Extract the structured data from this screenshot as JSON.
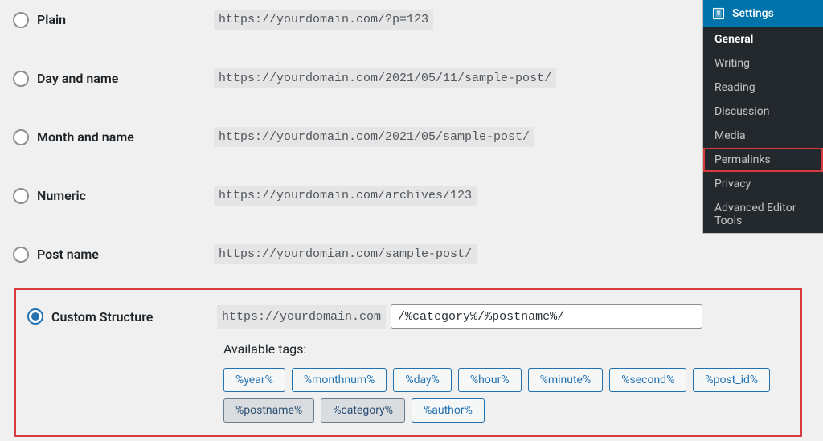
{
  "sidebar": {
    "header": "Settings",
    "items": [
      {
        "label": "General",
        "current": true,
        "highlight": false
      },
      {
        "label": "Writing",
        "current": false,
        "highlight": false
      },
      {
        "label": "Reading",
        "current": false,
        "highlight": false
      },
      {
        "label": "Discussion",
        "current": false,
        "highlight": false
      },
      {
        "label": "Media",
        "current": false,
        "highlight": false
      },
      {
        "label": "Permalinks",
        "current": false,
        "highlight": true
      },
      {
        "label": "Privacy",
        "current": false,
        "highlight": false
      },
      {
        "label": "Advanced Editor Tools",
        "current": false,
        "highlight": false
      }
    ]
  },
  "options": {
    "plain": {
      "label": "Plain",
      "url": "https://yourdomain.com/?p=123"
    },
    "dayname": {
      "label": "Day and name",
      "url": "https://yourdomain.com/2021/05/11/sample-post/"
    },
    "monthname": {
      "label": "Month and name",
      "url": "https://yourdomain.com/2021/05/sample-post/"
    },
    "numeric": {
      "label": "Numeric",
      "url": "https://yourdomain.com/archives/123"
    },
    "postname": {
      "label": "Post name",
      "url": "https://yourdomian.com/sample-post/"
    }
  },
  "custom": {
    "label": "Custom Structure",
    "base": "https://yourdomain.com",
    "value": "/%category%/%postname%/",
    "available_label": "Available tags:",
    "tags": [
      {
        "text": "%year%",
        "active": false
      },
      {
        "text": "%monthnum%",
        "active": false
      },
      {
        "text": "%day%",
        "active": false
      },
      {
        "text": "%hour%",
        "active": false
      },
      {
        "text": "%minute%",
        "active": false
      },
      {
        "text": "%second%",
        "active": false
      },
      {
        "text": "%post_id%",
        "active": false
      },
      {
        "text": "%postname%",
        "active": true
      },
      {
        "text": "%category%",
        "active": true
      },
      {
        "text": "%author%",
        "active": false
      }
    ]
  }
}
